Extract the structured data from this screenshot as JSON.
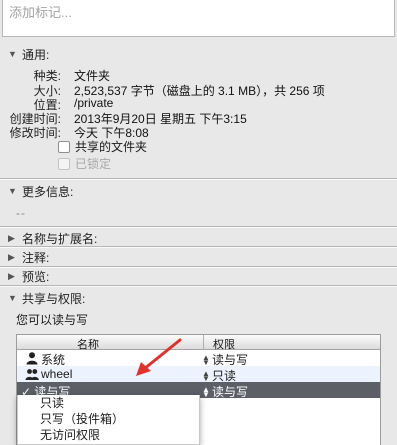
{
  "tags": {
    "placeholder": "添加标记..."
  },
  "general": {
    "header": "通用:",
    "rows": [
      {
        "key": "种类:",
        "value": "文件夹"
      },
      {
        "key": "大小:",
        "value": "2,523,537 字节（磁盘上的 3.1 MB），共 256 项"
      },
      {
        "key": "位置:",
        "value": "/private"
      },
      {
        "key": "创建时间:",
        "value": "2013年9月20日 星期五 下午3:15"
      },
      {
        "key": "修改时间:",
        "value": "今天 下午8:08"
      }
    ],
    "shared_folder_label": "共享的文件夹",
    "locked_label": "已锁定"
  },
  "more_info": {
    "header": "更多信息:",
    "placeholder": "--"
  },
  "name_ext": {
    "header": "名称与扩展名:"
  },
  "comments": {
    "header": "注释:"
  },
  "preview": {
    "header": "预览:"
  },
  "sharing": {
    "header": "共享与权限:",
    "status": "您可以读与写",
    "columns": {
      "name": "名称",
      "privilege": "权限"
    },
    "rows": [
      {
        "name": "系统",
        "privilege": "读与写"
      },
      {
        "name": "wheel",
        "privilege": "只读"
      },
      {
        "name": "✓ 读与写",
        "privilege": "读与写"
      }
    ],
    "menu": [
      "只读",
      "只写（投件箱）",
      "无访问权限"
    ]
  },
  "colors": {
    "arrow": "#e0322a",
    "selected_row": "#5c5f66"
  }
}
